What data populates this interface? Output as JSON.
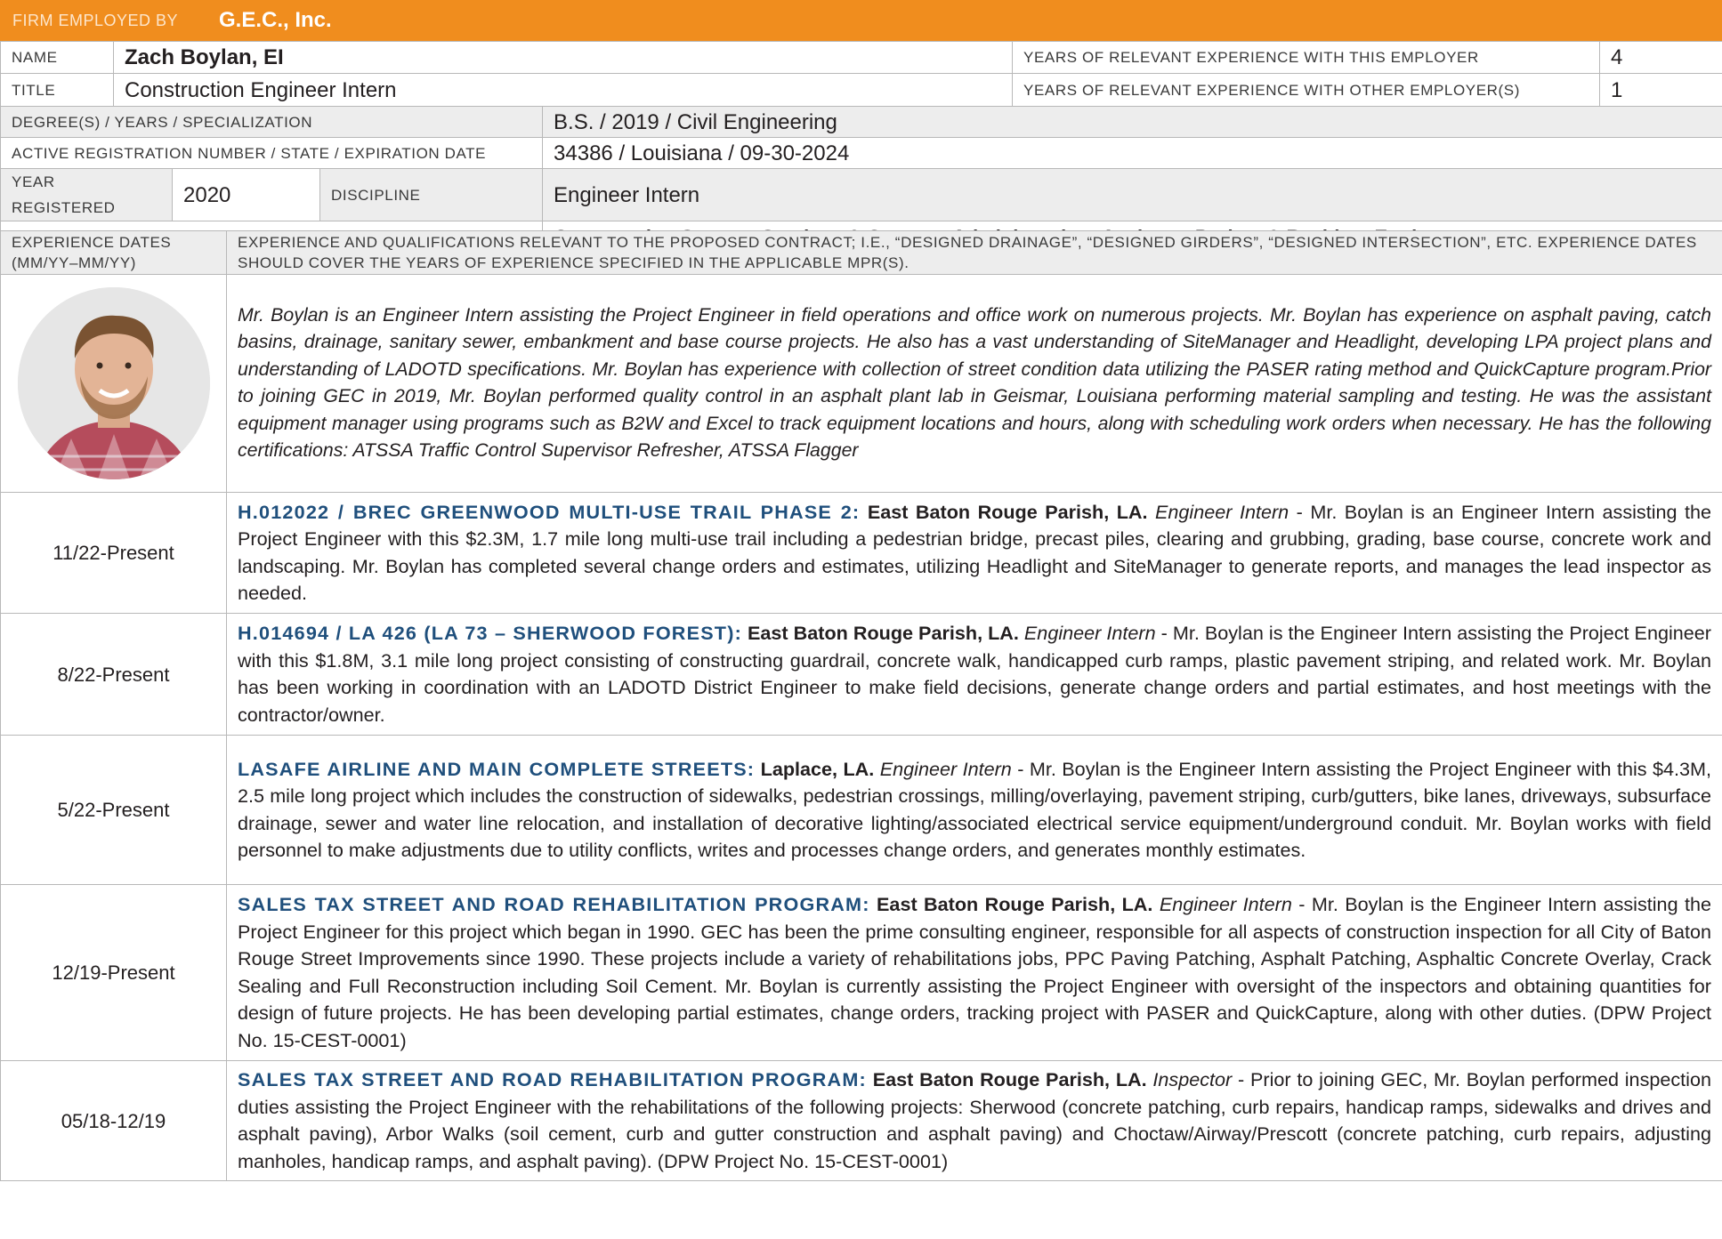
{
  "firm": {
    "label": "FIRM EMPLOYED BY",
    "name": "G.E.C., Inc."
  },
  "name": {
    "label": "NAME",
    "value": "Zach Boylan, EI"
  },
  "title": {
    "label": "TITLE",
    "value": "Construction Engineer Intern"
  },
  "years_this": {
    "label": "YEARS OF RELEVANT EXPERIENCE WITH THIS EMPLOYER",
    "value": "4"
  },
  "years_other": {
    "label": "YEARS OF RELEVANT EXPERIENCE WITH OTHER EMPLOYER(S)",
    "value": "1"
  },
  "degree": {
    "label": "DEGREE(S) / YEARS / SPECIALIZATION",
    "value": "B.S. / 2019 / Civil Engineering"
  },
  "registration": {
    "label": "ACTIVE REGISTRATION NUMBER / STATE / EXPIRATION DATE",
    "value": "34386 / Louisiana / 09-30-2024"
  },
  "year_registered": {
    "label": "YEAR REGISTERED",
    "value": "2020"
  },
  "discipline": {
    "label": "DISCIPLINE",
    "value": "Engineer Intern"
  },
  "contract_role": {
    "label": "CONTRACT ROLE(S) / BRIEF DESCRIPTION OF RESPONSIBILITIES",
    "value": "Construction Support Services & Contract Administration: Assistant Project & Resident Engineer"
  },
  "experience_header": {
    "dates_label": "EXPERIENCE DATES (MM/YY–MM/YY)",
    "description_label": "EXPERIENCE AND QUALIFICATIONS RELEVANT TO THE PROPOSED CONTRACT; I.E., “DESIGNED DRAINAGE”, “DESIGNED GIRDERS”, “DESIGNED INTERSECTION”, ETC. EXPERIENCE DATES SHOULD COVER THE YEARS OF EXPERIENCE SPECIFIED IN THE APPLICABLE MPR(S)."
  },
  "bio": "Mr. Boylan is an Engineer Intern assisting the Project Engineer in field operations and office work on numerous projects. Mr. Boylan has experience on asphalt paving, catch basins, drainage, sanitary sewer, embankment and base course projects. He also has a vast understanding of SiteManager and Headlight, developing LPA project plans and understanding of LADOTD specifications. Mr. Boylan has experience with collection of street condition data utilizing the PASER rating method and QuickCapture program.Prior to joining GEC in 2019, Mr. Boylan performed quality control in an asphalt plant lab in Geismar, Louisiana performing material sampling and testing. He was the assistant equipment manager using programs such as B2W and Excel to track equipment locations and hours, along with scheduling work orders when necessary. He has the following certifications: ATSSA Traffic Control Supervisor Refresher, ATSSA Flagger",
  "projects": [
    {
      "dates": "11/22-Present",
      "title": "H.012022 / BREC GREENWOOD MULTI-USE TRAIL PHASE 2:",
      "location": "East Baton Rouge Parish, LA.",
      "role": "Engineer Intern",
      "description": " - Mr. Boylan is an Engineer Intern assisting the Project Engineer with this $2.3M, 1.7 mile long multi-use trail including a pedestrian bridge, precast piles, clearing and grubbing, grading, base course, concrete work and landscaping. Mr. Boylan has completed several change orders and estimates, utilizing Headlight and SiteManager to generate reports, and manages the lead inspector as needed."
    },
    {
      "dates": "8/22-Present",
      "title": "H.014694 / LA 426 (LA 73 – SHERWOOD FOREST):",
      "location": "East Baton Rouge Parish, LA.",
      "role": "Engineer Intern",
      "description": " - Mr. Boylan is the Engineer Intern assisting the Project Engineer with this $1.8M, 3.1 mile long project consisting of constructing guardrail, concrete walk, handicapped curb ramps, plastic pavement striping, and related work. Mr. Boylan has been working in coordination with an LADOTD District Engineer to make field decisions, generate change orders and partial estimates, and host meetings with the contractor/owner."
    },
    {
      "dates": "5/22-Present",
      "title": "LASAFE AIRLINE AND MAIN COMPLETE STREETS:",
      "location": "Laplace, LA.",
      "role": "Engineer Intern",
      "description": " - Mr. Boylan is the Engineer Intern assisting the Project Engineer with this $4.3M, 2.5 mile long project which includes the construction of sidewalks, pedestrian crossings, milling/overlaying, pavement striping, curb/gutters, bike lanes, driveways, subsurface drainage, sewer and water line relocation, and installation of decorative lighting/associated electrical service equipment/underground conduit. Mr. Boylan works with field personnel to make adjustments due to utility conflicts, writes and processes change orders, and generates monthly estimates."
    },
    {
      "dates": "12/19-Present",
      "title": "SALES TAX STREET AND ROAD REHABILITATION PROGRAM:",
      "location": "East Baton Rouge Parish, LA.",
      "role": "Engineer Intern",
      "description": " - Mr. Boylan is the Engineer Intern assisting the Project Engineer for this project which began in 1990. GEC has been the prime consulting engineer, responsible for all aspects of construction inspection for all City of Baton Rouge Street Improvements since 1990. These projects include a variety of rehabilitations jobs, PPC Paving Patching, Asphalt Patching, Asphaltic Concrete Overlay, Crack Sealing and Full Reconstruction including Soil Cement. Mr. Boylan is currently assisting the Project Engineer with oversight of the inspectors and obtaining quantities for design of future projects. He has been developing partial estimates, change orders, tracking project with PASER and QuickCapture, along with other duties. (DPW Project No. 15-CEST-0001)"
    },
    {
      "dates": "05/18-12/19",
      "title": "SALES TAX STREET AND ROAD REHABILITATION PROGRAM:",
      "location": "East Baton Rouge Parish, LA.",
      "role": "Inspector",
      "description": " - Prior to joining GEC, Mr. Boylan performed inspection duties assisting the Project Engineer with the rehabilitations of the following projects: Sherwood (concrete patching, curb repairs, handicap ramps, sidewalks and drives and asphalt paving), Arbor Walks (soil cement, curb and gutter construction and asphalt paving) and Choctaw/Airway/Prescott (concrete patching, curb repairs, adjusting manholes, handicap ramps, and asphalt paving). (DPW Project No. 15-CEST-0001)"
    }
  ],
  "colors": {
    "firm_bar": "#f08d1e",
    "project_title": "#1f4f7c",
    "shaded_row": "#ededed"
  }
}
